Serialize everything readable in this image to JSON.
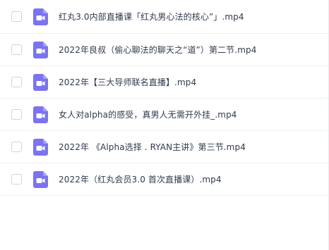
{
  "files": [
    {
      "name": "红丸3.0内部直播课「红丸男心法的核心”」.mp4",
      "icon": "video-file-icon"
    },
    {
      "name": "2022年良叔（偷心聊法的聊天之“道”）第二节.mp4",
      "icon": "video-file-icon"
    },
    {
      "name": "2022年【三大导师联名直播】.mp4",
      "icon": "video-file-icon"
    },
    {
      "name": "女人对alpha的感受，真男人无需开外挂_.mp4",
      "icon": "video-file-icon"
    },
    {
      "name": "2022年 《Alpha选择 . RYAN主讲》第三节.mp4",
      "icon": "video-file-icon"
    },
    {
      "name": "2022年（红丸会员3.0 首次直播课）.mp4",
      "icon": "video-file-icon"
    }
  ],
  "colors": {
    "icon_fill": "#7b73f0",
    "text": "#313a4c"
  }
}
